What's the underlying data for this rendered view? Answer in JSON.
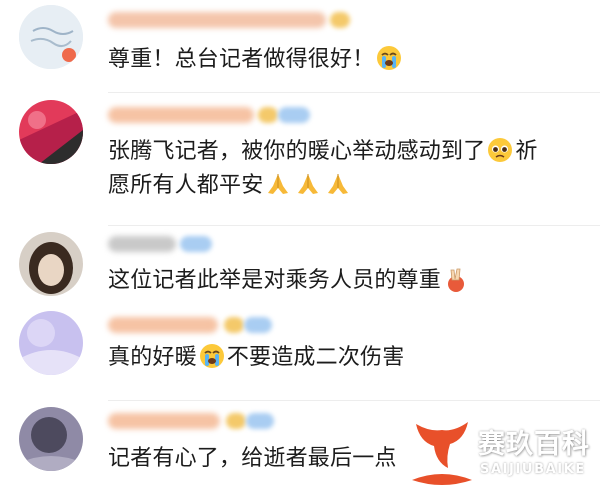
{
  "comments": [
    {
      "text_before": "尊重！总台记者做得很好！",
      "emoji": [
        "crying-face-emoji"
      ],
      "text_after": ""
    },
    {
      "line1": "张腾飞记者，被你的暖心举动感动到了",
      "line1_tail": "祈",
      "line2": "愿所有人都平安",
      "emoji": [
        "pleading-face-emoji",
        "praying-hands-emoji"
      ]
    },
    {
      "text_before": "这位记者此举是对乘务人员的尊重",
      "emoji": [
        "hand-emoji"
      ],
      "text_after": ""
    },
    {
      "text_before": "真的好暖",
      "emoji": [
        "crying-face-emoji"
      ],
      "text_after": "不要造成二次伤害"
    },
    {
      "text_before": "记者有心了，给逝者最后一点",
      "emoji": [],
      "text_after": ""
    }
  ],
  "watermark": {
    "title": "赛玖百科",
    "subtitle": "SAIJIUBAIKE",
    "color": "#e8502a"
  },
  "colors": {
    "text": "#1c1c1c",
    "username_blur": "#f3c2a7",
    "badge_blue": "#a9cdf2",
    "badge_gold": "#f4c96a"
  }
}
